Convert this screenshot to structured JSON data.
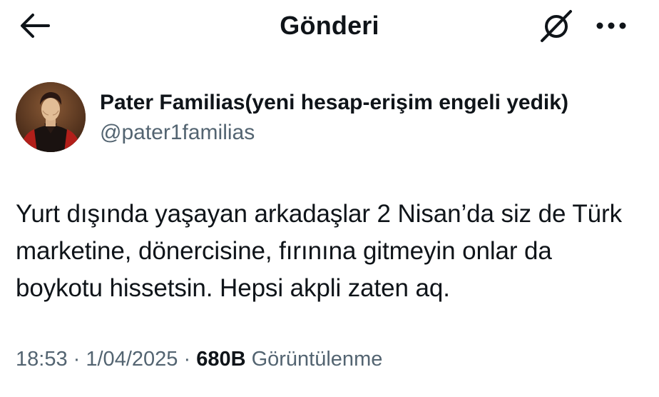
{
  "header": {
    "title": "Gönderi",
    "back_icon": "back-arrow-icon",
    "grok_icon": "grok-icon",
    "more_icon": "more-horizontal-icon"
  },
  "post": {
    "author": {
      "display_name": "Pater Familias(yeni hesap-erişim engeli yedik)",
      "handle": "@pater1familias",
      "avatar_icon": "avatar-portrait"
    },
    "text": "Yurt dışında yaşayan arkadaşlar 2 Nisan’da siz de Türk marketine, dönercisine, fırınına gitmeyin onlar da boykotu hissetsin. Hepsi akpli zaten aq.",
    "time": "18:53",
    "separator": "·",
    "date": "1/04/2025",
    "views_count": "680B",
    "views_label": "Görüntülenme"
  },
  "colors": {
    "text_primary": "#0f1419",
    "text_secondary": "#536471",
    "background": "#ffffff"
  }
}
